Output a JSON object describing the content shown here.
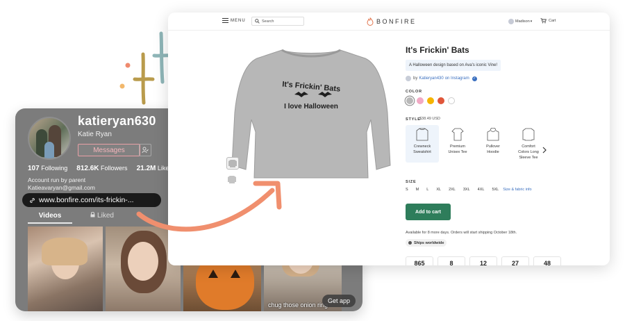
{
  "tiktok": {
    "username": "katieryan630",
    "display_name": "Katie Ryan",
    "messages_label": "Messages",
    "stats": {
      "following_count": "107",
      "following_label": "Following",
      "followers_count": "812.6K",
      "followers_label": "Followers",
      "likes_count": "21.2M",
      "likes_label": "Likes"
    },
    "bio_line1": "Account run by parent",
    "bio_line2": "Katieavaryan@gmail.com",
    "link": "www.bonfire.com/its-frickin-...",
    "tabs": {
      "videos": "Videos",
      "liked": "Liked"
    },
    "thumb_caption": "chug those onion ring",
    "get_app": "Get app"
  },
  "bonfire": {
    "nav": {
      "menu": "MENU",
      "search_placeholder": "Search",
      "logo": "BONFIRE",
      "user": "Madison",
      "cart": "Cart"
    },
    "product": {
      "title": "It's Frickin' Bats",
      "description": "A Halloween design based on Ava's iconic Vine!",
      "by_prefix": "by",
      "by_user": "Katieryan430",
      "by_suffix": "on Instagram",
      "shirt_text_line1": "It's Frickin' Bats",
      "shirt_text_line2": "I love Halloween"
    },
    "color_label": "COLOR",
    "colors": [
      "#b8b8b8",
      "#f2a9c4",
      "#f5b400",
      "#e0563a",
      "#ffffff"
    ],
    "style_label": "STYLE",
    "style_price": "$38.49 USD",
    "styles": [
      {
        "line1": "Crewneck",
        "line2": "Sweatshirt",
        "line3": ""
      },
      {
        "line1": "Premium",
        "line2": "Unisex Tee",
        "line3": ""
      },
      {
        "line1": "Pullover",
        "line2": "Hoodie",
        "line3": ""
      },
      {
        "line1": "Comfort",
        "line2": "Colors Long",
        "line3": "Sleeve Tee"
      }
    ],
    "size_label": "SIZE",
    "sizes": [
      "S",
      "M",
      "L",
      "XL",
      "2XL",
      "3XL",
      "4XL",
      "5XL"
    ],
    "size_info": "Size & fabric info",
    "add_to_cart": "Add to cart",
    "availability": "Available for 8 more days. Orders will start shipping October 18th.",
    "ships": "Ships worldwide",
    "counters": [
      "865",
      "8",
      "12",
      "27",
      "48"
    ]
  }
}
